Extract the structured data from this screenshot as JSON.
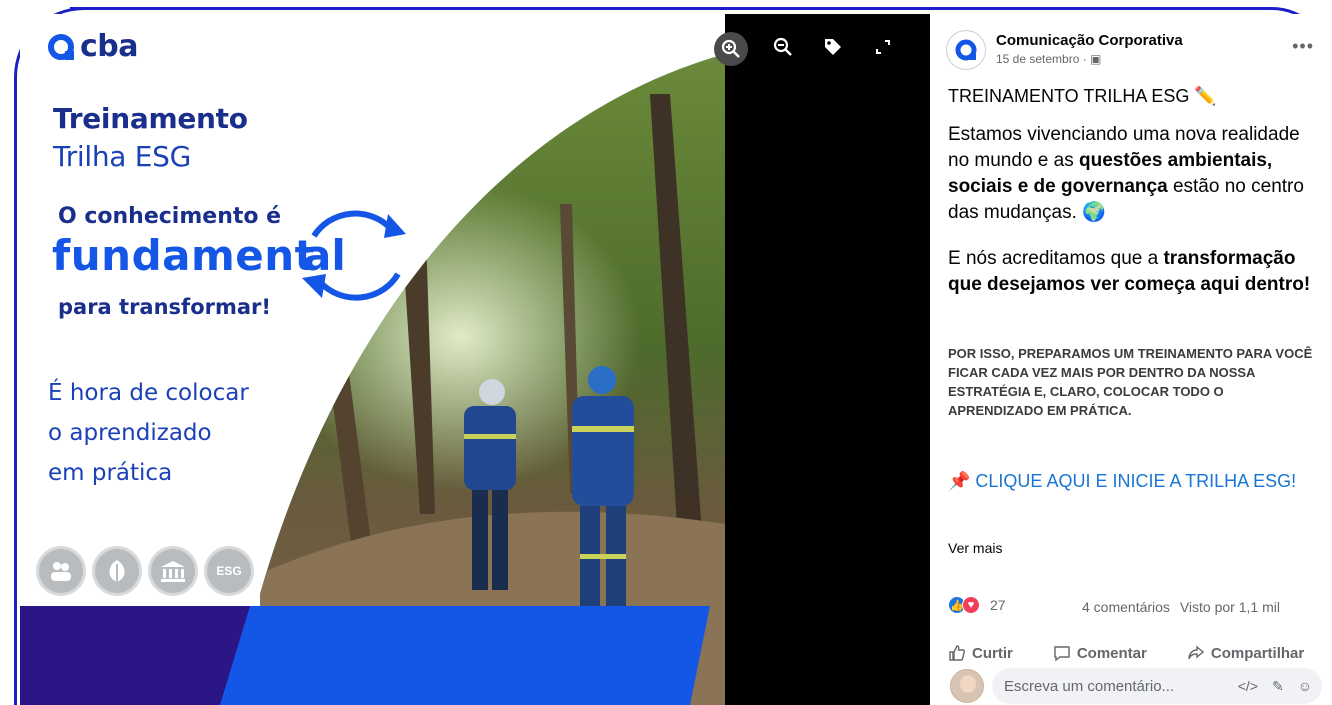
{
  "colors": {
    "brand_navy": "#1a2f8c",
    "brand_blue": "#1457e6",
    "brand_purple": "#2c1687",
    "link_blue": "#1876d2",
    "frame_blue": "#1c1fc8"
  },
  "image": {
    "brand": "cba",
    "heading_line1": "Treinamento",
    "heading_line2": "Trilha ESG",
    "slogan_line1": "O conhecimento é",
    "slogan_word": "fundament",
    "slogan_suffix": "al",
    "slogan_line3": "para transformar!",
    "body_lines": [
      "É hora de colocar",
      "o aprendizado",
      "em prática"
    ],
    "pillar_icons": [
      "people-icon",
      "leaf-icon",
      "institution-icon",
      "esg-icon"
    ],
    "pillar_esg_label": "ESG"
  },
  "viewer_tools": [
    {
      "name": "zoom-in-icon",
      "glyph": "⊕"
    },
    {
      "name": "zoom-out-icon",
      "glyph": "⊖"
    },
    {
      "name": "tag-icon",
      "glyph": "tag"
    },
    {
      "name": "fullscreen-icon",
      "glyph": "⤢"
    }
  ],
  "post": {
    "page_name": "Comunicação Corporativa",
    "date": "15 de setembro",
    "privacy_icon": "company-icon",
    "title": "TREINAMENTO TRILHA ESG ✏️",
    "p1_a": "Estamos vivenciando uma nova realidade no mundo e as ",
    "p1_b": "questões ambientais, sociais e de governança",
    "p1_c": " estão no centro das mudanças. 🌍",
    "p2_a": "E nós acreditamos que a ",
    "p2_b": "transformação que desejamos ver começa aqui dentro!",
    "p3": "POR ISSO, PREPARAMOS UM TREINAMENTO PARA VOCÊ FICAR CADA VEZ MAIS POR DENTRO DA NOSSA ESTRATÉGIA E, CLARO, COLOCAR TODO O APRENDIZADO EM PRÁTICA.",
    "cta": "📌 CLIQUE AQUI E INICIE A TRILHA ESG!",
    "see_more": "Ver mais",
    "reaction_count": "27",
    "comments": "4 comentários",
    "views": "Visto por 1,1 mil",
    "actions": {
      "like": "Curtir",
      "comment": "Comentar",
      "share": "Compartilhar"
    },
    "comment_placeholder": "Escreva um comentário..."
  }
}
